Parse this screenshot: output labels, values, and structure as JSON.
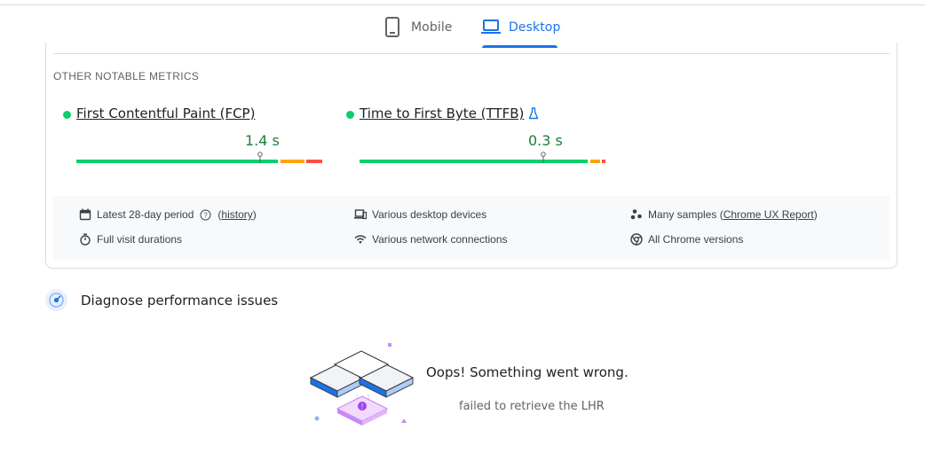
{
  "tabs": {
    "mobile_label": "Mobile",
    "desktop_label": "Desktop",
    "active": "Desktop"
  },
  "section": {
    "title": "OTHER NOTABLE METRICS"
  },
  "metrics": [
    {
      "name": "First Contentful Paint (FCP)",
      "value": "1.4 s",
      "status": "good",
      "distribution": {
        "good": 0.83,
        "needs_improvement": 0.1,
        "poor": 0.07
      },
      "marker_percentile": 0.75
    },
    {
      "name": "Time to First Byte (TTFB)",
      "value": "0.3 s",
      "status": "good",
      "experimental": true,
      "distribution": {
        "good": 0.93,
        "needs_improvement": 0.05,
        "poor": 0.02
      },
      "marker_percentile": 0.75
    }
  ],
  "info": {
    "period": "Latest 28-day period",
    "history_link": "history",
    "devices": "Various desktop devices",
    "samples_prefix": "Many samples (",
    "samples_link": "Chrome UX Report",
    "samples_suffix": ")",
    "durations": "Full visit durations",
    "network": "Various network connections",
    "versions": "All Chrome versions"
  },
  "diagnose": {
    "title": "Diagnose performance issues"
  },
  "error": {
    "title": "Oops! Something went wrong.",
    "message": "failed to retrieve the LHR"
  },
  "colors": {
    "good": "#0cce6b",
    "average": "#ffa400",
    "poor": "#ff4e42",
    "accent": "#1a73e8"
  }
}
